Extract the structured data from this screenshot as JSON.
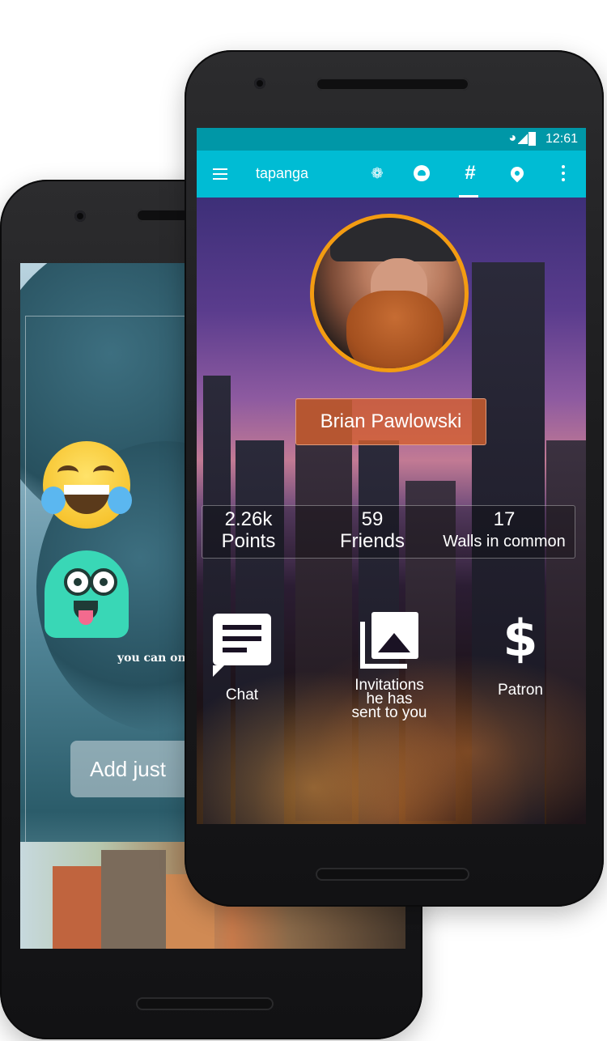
{
  "status_bar": {
    "time": "12:61"
  },
  "app_bar": {
    "title": "tapanga",
    "icons": [
      "menu-icon",
      "skype-icon",
      "groups-icon",
      "hashtag-icon",
      "location-pin-icon",
      "more-vert-icon"
    ],
    "hashtag_glyph": "#"
  },
  "profile": {
    "name": "Brian Pawlowski",
    "stats": [
      {
        "value": "2.26k",
        "label": "Points"
      },
      {
        "value": "59",
        "label": "Friends"
      },
      {
        "value": "17",
        "label": "Walls in common"
      }
    ],
    "actions": [
      {
        "icon": "chat-icon",
        "label": "Chat"
      },
      {
        "icon": "photo-library-icon",
        "label_lines": [
          "Invitations",
          "he has",
          "sent to you"
        ]
      },
      {
        "icon": "dollar-icon",
        "label": "Patron",
        "glyph": "$"
      }
    ]
  },
  "back_screen": {
    "caption": "you can on",
    "button_label": "Add just"
  },
  "colors": {
    "status_bar": "#0097a7",
    "app_bar": "#00bcd4",
    "avatar_ring": "#f39c12",
    "name_box": "#d6602e"
  }
}
